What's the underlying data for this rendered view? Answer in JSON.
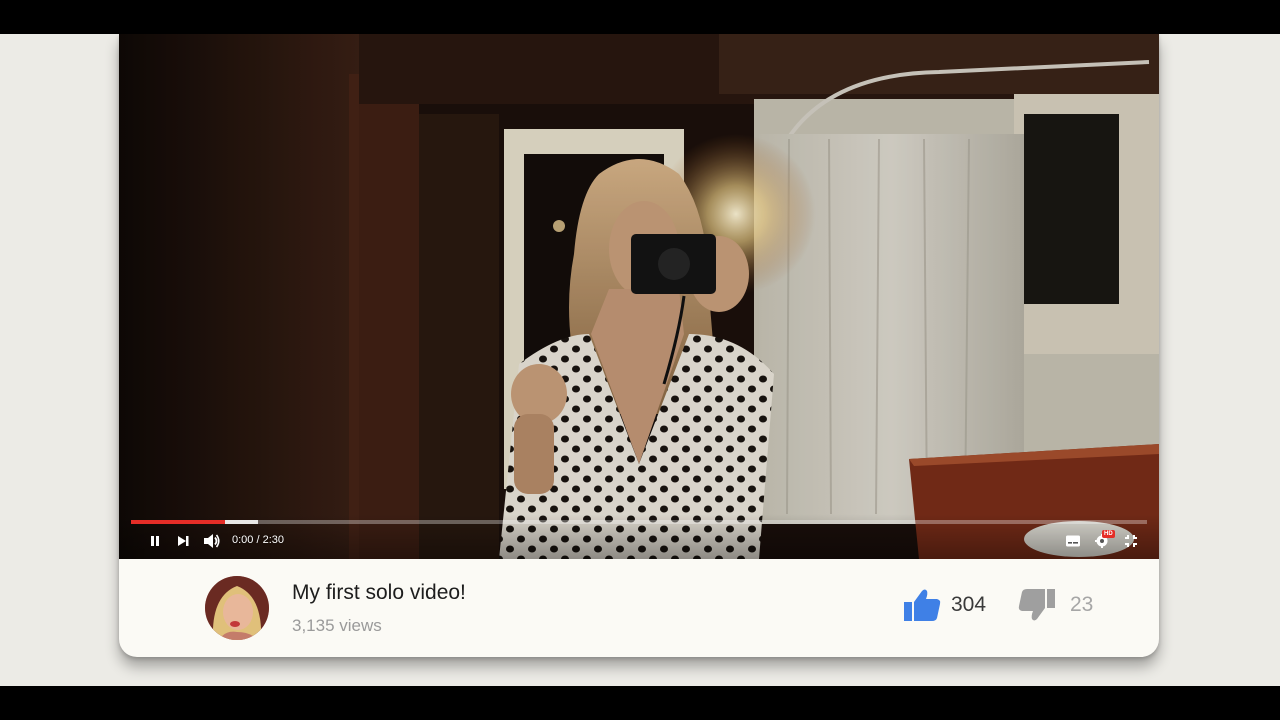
{
  "player": {
    "current_time": "0:00",
    "separator": "/",
    "duration": "2:30",
    "time_display": "0:00 / 2:30",
    "played_fraction": 0.093,
    "buffered_fraction": 0.125,
    "hd_badge": "HD",
    "accent_color": "#e52d27"
  },
  "video_info": {
    "title": "My first solo video!",
    "views": "3,135 views",
    "likes": "304",
    "dislikes": "23",
    "like_color": "#3f80e6",
    "dislike_color": "#9f9f9f"
  },
  "icons": {
    "play_pause": "pause-icon",
    "next": "skip-next-icon",
    "volume": "volume-icon",
    "captions": "captions-icon",
    "settings": "settings-gear-icon",
    "fullscreen": "exit-fullscreen-icon",
    "like": "thumbs-up-icon",
    "dislike": "thumbs-down-icon"
  }
}
